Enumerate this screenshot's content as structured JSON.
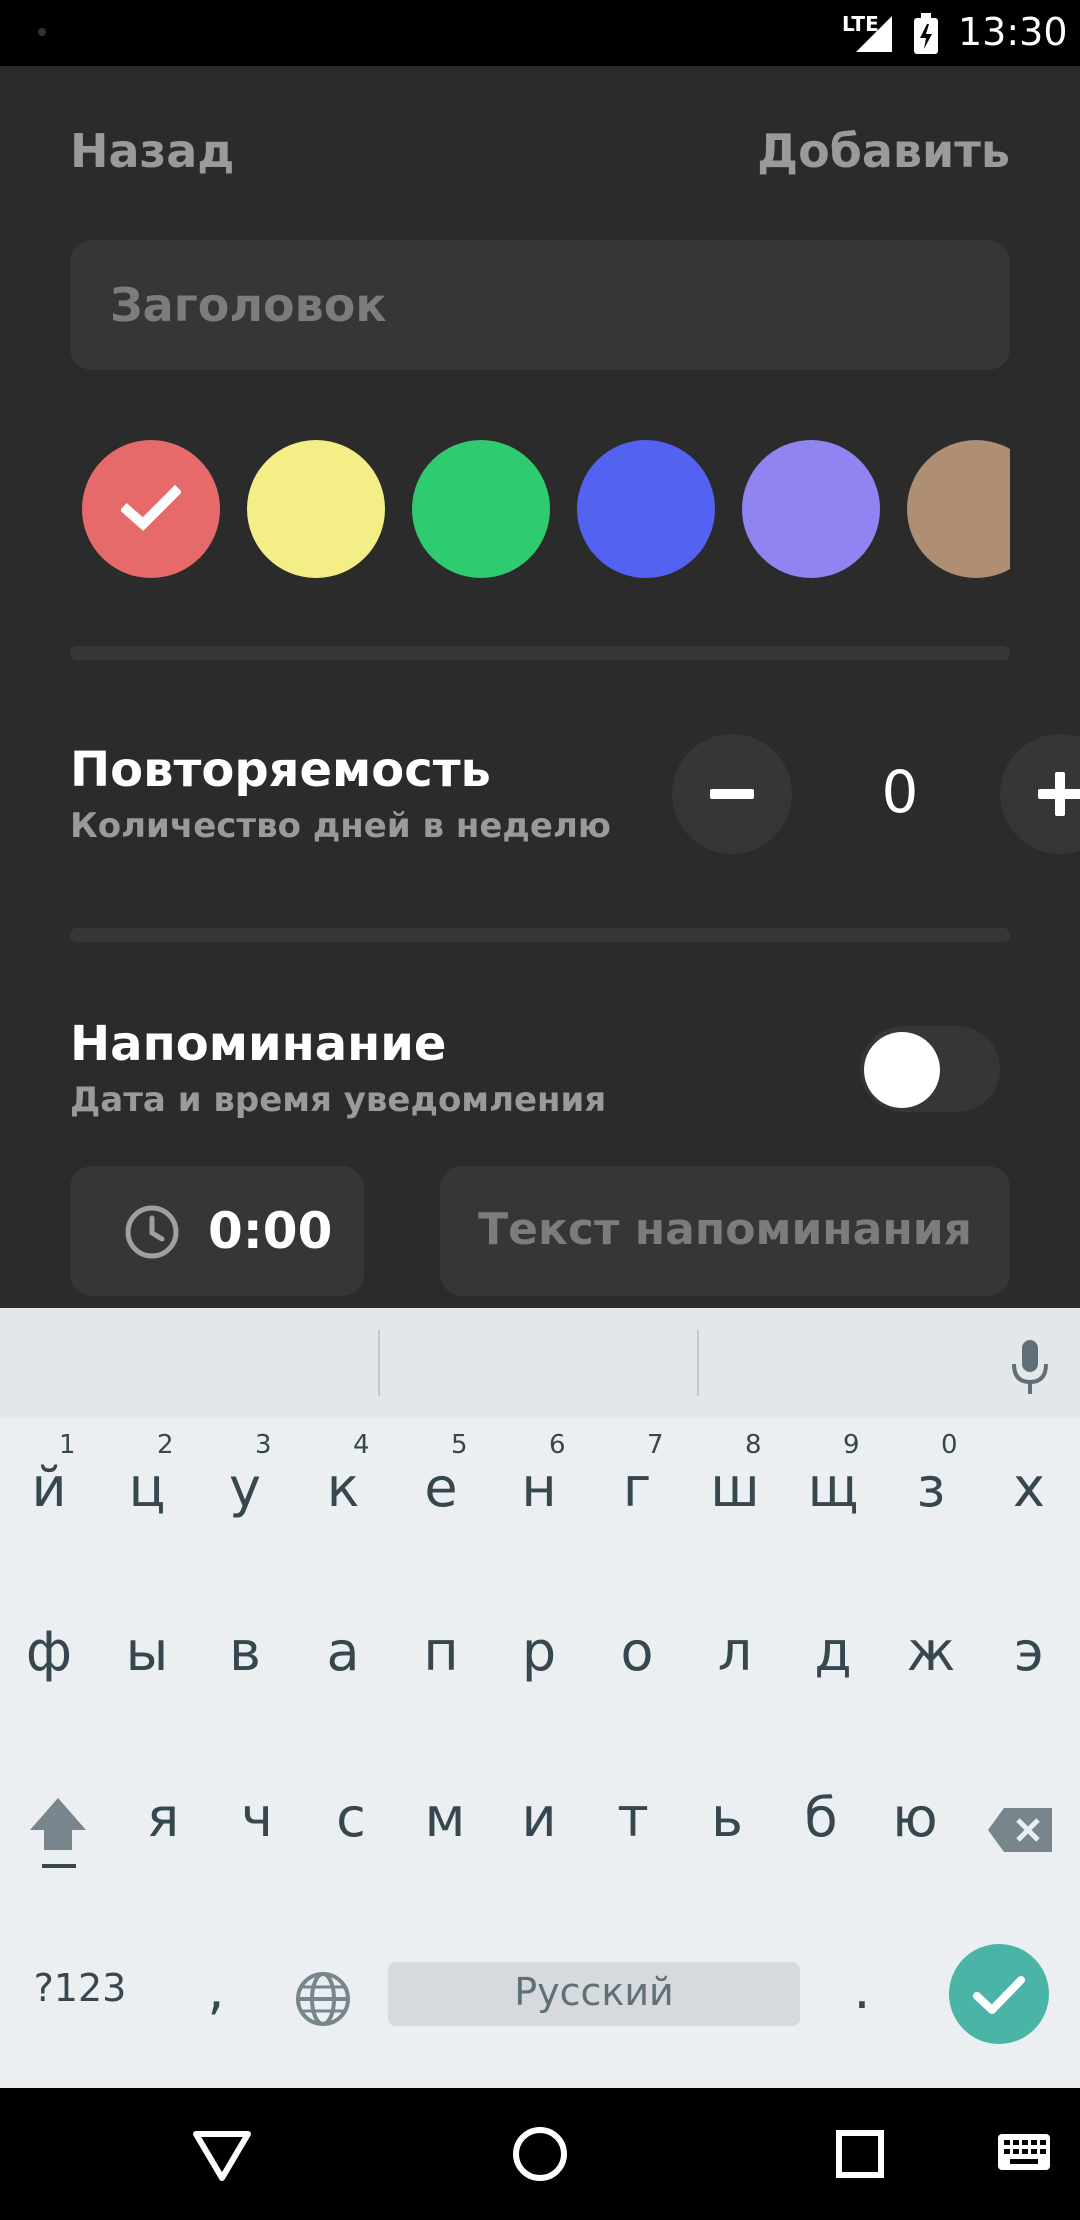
{
  "status_bar": {
    "network": "LTE",
    "time": "13:30"
  },
  "header": {
    "back_label": "Назад",
    "add_label": "Добавить"
  },
  "title_input": {
    "placeholder": "Заголовок"
  },
  "colors": {
    "selected_index": 0,
    "swatches": [
      "#e76a6a",
      "#f4ee86",
      "#2ecb71",
      "#5362f0",
      "#8f84f2",
      "#ae8f74"
    ]
  },
  "repeat": {
    "title": "Повторяемость",
    "subtitle": "Количество дней в неделю",
    "minus_label": "−",
    "value": "0",
    "plus_label": "+"
  },
  "reminder": {
    "title": "Напоминание",
    "subtitle": "Дата и время уведомления",
    "enabled": false,
    "time": "0:00",
    "text_placeholder": "Текст напоминания"
  },
  "keyboard": {
    "row1": [
      "й",
      "ц",
      "у",
      "к",
      "е",
      "н",
      "г",
      "ш",
      "щ",
      "з",
      "х"
    ],
    "row1_numbers": [
      "1",
      "2",
      "3",
      "4",
      "5",
      "6",
      "7",
      "8",
      "9",
      "0"
    ],
    "row2": [
      "ф",
      "ы",
      "в",
      "а",
      "п",
      "р",
      "о",
      "л",
      "д",
      "ж",
      "э"
    ],
    "row3": [
      "я",
      "ч",
      "с",
      "м",
      "и",
      "т",
      "ь",
      "б",
      "ю"
    ],
    "symbols_label": "?123",
    "comma": ",",
    "space_label": "Русский",
    "period": "."
  },
  "nav_bar": {
    "buttons": [
      "back",
      "home",
      "recents",
      "keyboard"
    ]
  }
}
